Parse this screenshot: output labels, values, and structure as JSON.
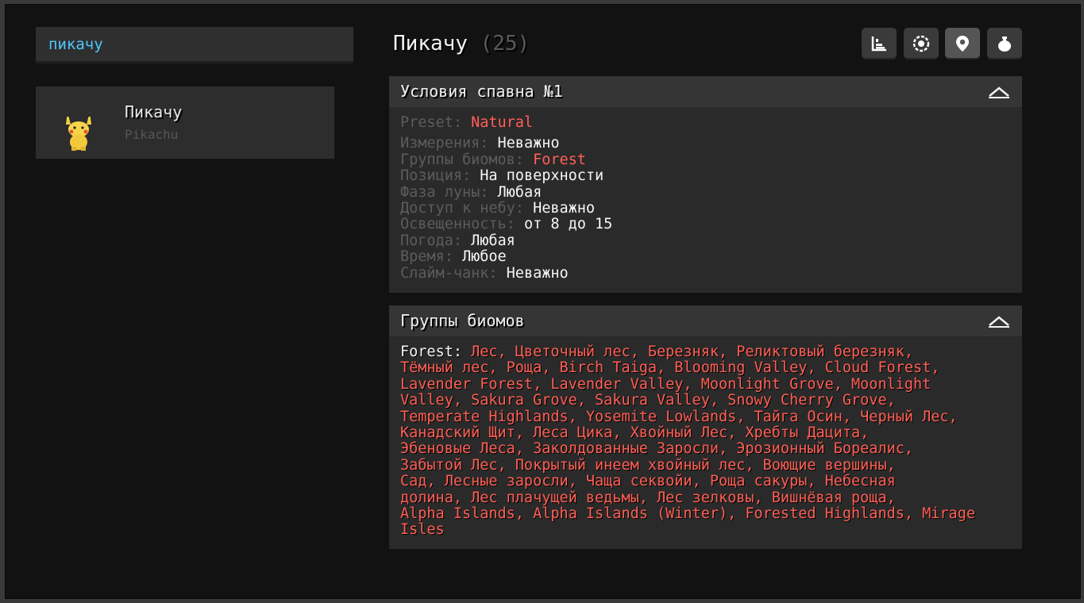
{
  "search": {
    "value": "пикачу"
  },
  "result": {
    "name": "Пикачу",
    "subtitle": "Pikachu"
  },
  "header": {
    "title": "Пикачу",
    "number": "(25)"
  },
  "tabs": [
    {
      "icon": "stats-chart-icon",
      "active": false
    },
    {
      "icon": "evolution-icon",
      "active": false
    },
    {
      "icon": "location-pin-icon",
      "active": true
    },
    {
      "icon": "drops-bag-icon",
      "active": false
    }
  ],
  "spawn": {
    "title": "Условия спавна №1",
    "preset": {
      "label": "Preset:",
      "value": "Natural"
    },
    "rows": [
      {
        "label": "Измерения:",
        "value": "Неважно"
      },
      {
        "label": "Группы биомов:",
        "value": "Forest"
      },
      {
        "label": "Позиция:",
        "value": "На поверхности"
      },
      {
        "label": "Фаза луны:",
        "value": "Любая"
      },
      {
        "label": "Доступ к небу:",
        "value": "Неважно"
      },
      {
        "label": "Освещенность:",
        "value": "от 8 до 15"
      },
      {
        "label": "Погода:",
        "value": "Любая"
      },
      {
        "label": "Время:",
        "value": "Любое"
      },
      {
        "label": "Слайм-чанк:",
        "value": "Неважно"
      }
    ]
  },
  "biomes": {
    "title": "Группы биомов",
    "group_label": "Forest:",
    "lines": [
      "Лес, Цветочный лес, Березняк, Реликтовый березняк,",
      "Тёмный лес, Роща, Birch Taiga, Blooming Valley, Cloud Forest,",
      "Lavender Forest, Lavender Valley, Moonlight Grove, Moonlight",
      "Valley, Sakura Grove, Sakura Valley, Snowy Cherry Grove,",
      "Temperate Highlands, Yosemite Lowlands, Тайга Осин, Черный Лес,",
      "Канадский Щит, Леса Цика, Хвойный Лес, Хребты Дацита,",
      "Эбеновые Леса, Заколдованные Заросли, Эрозионный Бореалис,",
      "Забытой Лес, Покрытый инеем хвойный лес, Воющие вершины,",
      "Сад, Лесные заросли, Чаща секвойи, Роща сакуры, Небесная",
      "долина, Лес плачущей ведьмы, Лес зелковы, Вишнёвая роща,",
      "Alpha Islands, Alpha Islands (Winter), Forested Highlands, Mirage",
      "Isles"
    ]
  },
  "colors": {
    "accent_value": "#ff5f55",
    "search_text": "#4fc8ff",
    "label_gray": "#5c5c5c"
  }
}
